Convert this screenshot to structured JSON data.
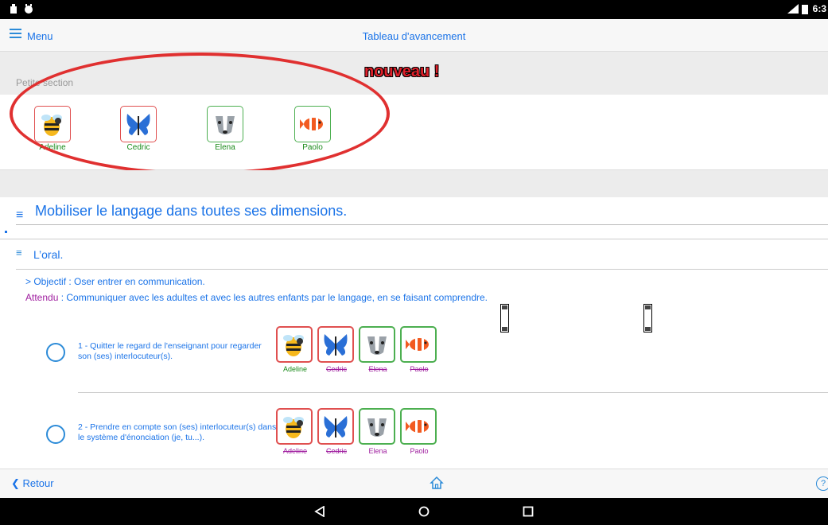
{
  "status_bar": {
    "time": "6:3"
  },
  "header": {
    "menu_label": "Menu",
    "title": "Tableau d'avancement"
  },
  "badge": "nouveau !",
  "section_label": "Petite section",
  "children": [
    {
      "name": "Adeline",
      "animal": "bee-icon",
      "border": "#e05050"
    },
    {
      "name": "Cedric",
      "animal": "butterfly-icon",
      "border": "#e05050"
    },
    {
      "name": "Elena",
      "animal": "badger-icon",
      "border": "#4caf50"
    },
    {
      "name": "Paolo",
      "animal": "fish-icon",
      "border": "#4caf50"
    }
  ],
  "domain": {
    "title": "Mobiliser le langage dans toutes ses dimensions."
  },
  "subdomain": {
    "title": "L’oral."
  },
  "objective": {
    "line": "> Objectif : Oser entrer en communication.",
    "attendu_label": "Attendu",
    "attendu_text": " : Communiquer avec les adultes et avec les autres enfants par le langage, en se faisant comprendre."
  },
  "criteria": [
    {
      "text": "1 - Quitter le regard de l'enseignant pour regarder son (ses) interlocuteur(s).",
      "kids": [
        {
          "name": "Adeline",
          "state": "plain"
        },
        {
          "name": "Cedric",
          "state": "struck"
        },
        {
          "name": "Elena",
          "state": "struck"
        },
        {
          "name": "Paolo",
          "state": "struck"
        }
      ]
    },
    {
      "text": "2 - Prendre en compte son (ses) interlocuteur(s) dans le système d'énonciation (je, tu...).",
      "kids": [
        {
          "name": "Adeline",
          "state": "struck"
        },
        {
          "name": "Cedric",
          "state": "struck"
        },
        {
          "name": "Elena",
          "state": "plain"
        },
        {
          "name": "Paolo",
          "state": "plain"
        }
      ]
    }
  ],
  "footer": {
    "back_label": "Retour",
    "help": "?"
  },
  "colors": {
    "accent": "#1a73e8",
    "red": "#e05050",
    "green": "#4caf50",
    "attendu": "#a020a0"
  }
}
